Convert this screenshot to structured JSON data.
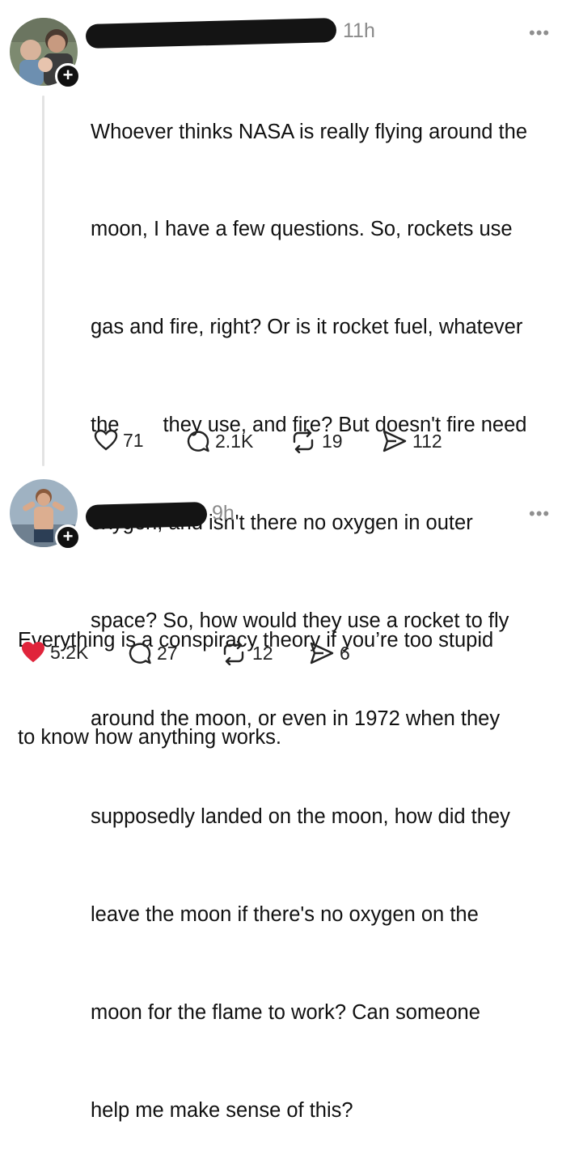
{
  "post1": {
    "time": "11h",
    "more_label": "•••",
    "text_lines": [
      "Whoever thinks NASA is really flying around the",
      "moon, I have a few questions. So, rockets use",
      "gas and fire, right? Or is it rocket fuel, whatever",
      "they use, and fire? But doesn't fire need",
      "oxygen, and isn't there no oxygen in outer",
      "space? So, how would they use a rocket to fly",
      "around the moon, or even in 1972 when they",
      "supposedly landed on the moon, how did they",
      "leave the moon if there's no oxygen on the",
      "moon for the flame to work? Can someone",
      "help me make sense of this?"
    ],
    "text_line4_prefix": "the",
    "likes": "71",
    "replies": "2.1K",
    "reposts": "19",
    "shares": "112"
  },
  "post2": {
    "time": "9h",
    "more_label": "•••",
    "text_lines": [
      "Everything is a conspiracy theory if you’re too stupid",
      "to know how anything works."
    ],
    "likes": "5.2K",
    "replies": "27",
    "reposts": "12",
    "shares": "6"
  },
  "colors": {
    "like_active": "#e0243b",
    "icon": "#222222",
    "muted": "#8a8a8a"
  },
  "icons": {
    "like": "heart-icon",
    "reply": "speech-bubble-icon",
    "repost": "repost-icon",
    "share": "send-icon",
    "follow": "plus-icon"
  }
}
